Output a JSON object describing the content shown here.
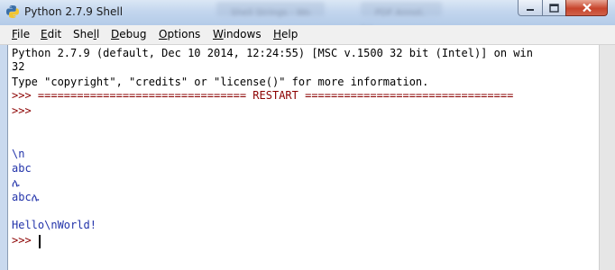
{
  "window": {
    "title": "Python 2.7.9 Shell",
    "background_tabs": [
      "Shell Strings - Wo",
      "PDF Annot. Ed."
    ]
  },
  "controls": {
    "minimize_icon": "minimize-icon",
    "maximize_icon": "maximize-icon",
    "close_icon": "close-icon"
  },
  "menu": {
    "items": [
      {
        "label": "File",
        "accel": "F"
      },
      {
        "label": "Edit",
        "accel": "E"
      },
      {
        "label": "Shell",
        "accel": "l"
      },
      {
        "label": "Debug",
        "accel": "D"
      },
      {
        "label": "Options",
        "accel": "O"
      },
      {
        "label": "Windows",
        "accel": "W"
      },
      {
        "label": "Help",
        "accel": "H"
      }
    ]
  },
  "shell": {
    "lines": [
      {
        "text": "Python 2.7.9 (default, Dec 10 2014, 12:24:55) [MSC v.1500 32 bit (Intel)] on win",
        "kind": "out"
      },
      {
        "text": "32",
        "kind": "out"
      },
      {
        "text": "Type \"copyright\", \"credits\" or \"license()\" for more information.",
        "kind": "out"
      },
      {
        "text": ">>> ================================ RESTART ================================",
        "kind": "prompt"
      },
      {
        "text": ">>>",
        "kind": "prompt"
      },
      {
        "text": "",
        "kind": "out"
      },
      {
        "text": "",
        "kind": "out"
      },
      {
        "text": "\\n",
        "kind": "stdout"
      },
      {
        "text": "abc",
        "kind": "stdout"
      },
      {
        "text": "ሌ",
        "kind": "stdout"
      },
      {
        "text": "abcሌ",
        "kind": "stdout"
      },
      {
        "text": "",
        "kind": "out"
      },
      {
        "text": "Hello\\nWorld!",
        "kind": "stdout"
      },
      {
        "text": ">>>",
        "kind": "prompt"
      }
    ]
  },
  "colors": {
    "prompt": "#8b0000",
    "stdout": "#2233aa",
    "output": "#000000"
  }
}
